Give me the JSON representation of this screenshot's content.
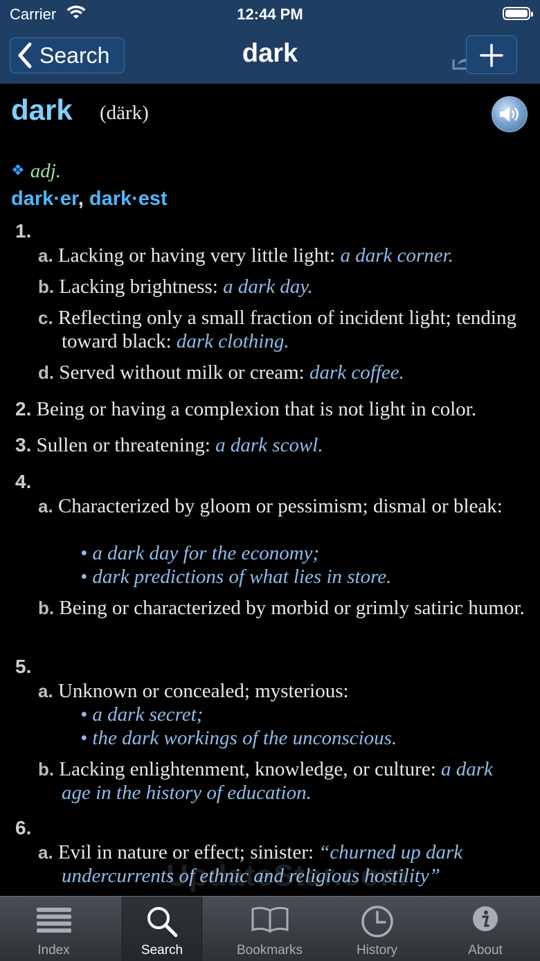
{
  "status": {
    "carrier": "Carrier",
    "time": "12:44 PM"
  },
  "nav": {
    "back_label": "Search",
    "title": "dark"
  },
  "entry": {
    "headword": "dark",
    "pronunciation": "(därk)",
    "pos": "adj.",
    "diamond": "❖",
    "inflections": [
      "dark·er",
      "dark·est"
    ],
    "inflection_sep": ",",
    "senses": [
      {
        "num": "1."
      },
      {
        "letter": "a.",
        "text": "Lacking or having very little light: ",
        "example": "a dark corner."
      },
      {
        "letter": "b.",
        "text": "Lacking brightness: ",
        "example": "a dark day."
      },
      {
        "letter": "c.",
        "text": "Reflecting only a small fraction of incident light; tending toward black: ",
        "example": "dark clothing."
      },
      {
        "letter": "d.",
        "text": "Served without milk or cream: ",
        "example": "dark coffee."
      },
      {
        "num": "2.",
        "text": "Being or having a complexion that is not light in color."
      },
      {
        "num": "3.",
        "text": "Sullen or threatening: ",
        "example": "a dark scowl."
      },
      {
        "num": "4."
      },
      {
        "letter": "a.",
        "text": "Characterized by gloom or pessimism; dismal or bleak:"
      },
      {
        "bullet": "• a dark day for the economy;"
      },
      {
        "bullet": "• dark predictions of what lies in store."
      },
      {
        "letter": "b.",
        "text": "Being or characterized by morbid or grimly satiric humor."
      },
      {
        "num": "5."
      },
      {
        "letter": "a.",
        "text": "Unknown or concealed; mysterious:"
      },
      {
        "bullet": "• a dark secret;"
      },
      {
        "bullet": "• the dark workings of the unconscious."
      },
      {
        "letter": "b.",
        "text": "Lacking enlightenment, knowledge, or culture: ",
        "example": "a dark age in the history of education."
      },
      {
        "num": "6."
      },
      {
        "letter": "a.",
        "text": "Evil in nature or effect; sinister: ",
        "example": "“churned up dark undercurrents of ethnic and religious hostility”"
      }
    ]
  },
  "watermark": "UpdateStar.com",
  "tabs": [
    {
      "label": "Index",
      "icon": "list-icon"
    },
    {
      "label": "Search",
      "icon": "magnifier-icon",
      "active": true
    },
    {
      "label": "Bookmarks",
      "icon": "book-icon"
    },
    {
      "label": "History",
      "icon": "clock-icon"
    },
    {
      "label": "About",
      "icon": "info-icon"
    }
  ],
  "colors": {
    "nav_bg": "#1e3e63",
    "headword": "#7fd0ff",
    "inflection": "#4fb6ff",
    "example": "#8fbce8",
    "pos": "#9fe3a1"
  }
}
